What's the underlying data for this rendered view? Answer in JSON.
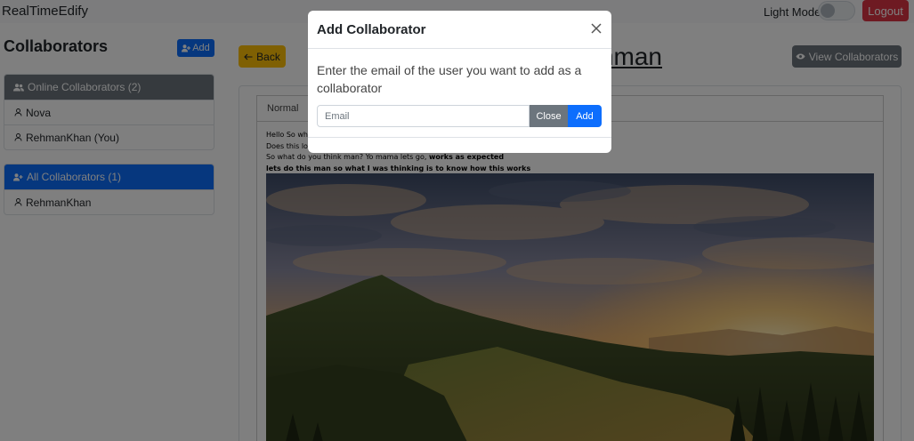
{
  "app": {
    "brand": "RealTimeEdify",
    "theme_label": "Light Mode",
    "logout_label": "Logout"
  },
  "sidebar": {
    "title": "Collaborators",
    "add_label": "Add",
    "online_header": "Online Collaborators (2)",
    "online_items": [
      "Nova",
      "RehmanKhan (You)"
    ],
    "all_header": "All Collaborators (1)",
    "all_items": [
      "RehmanKhan"
    ]
  },
  "main": {
    "back_label": "Back",
    "doc_title": "Khan Rehman",
    "view_collaborators_label": "View Collaborators",
    "toolbar_format": "Normal",
    "editor_lines": [
      "Hello So wh",
      "Does this lo",
      "So what do you think man? Yo mama lets go, ",
      "works as expected",
      "lets do this man so what I was thinking is to know how this works"
    ]
  },
  "modal": {
    "title": "Add Collaborator",
    "description": "Enter the email of the user you want to add as a collaborator",
    "email_placeholder": "Email",
    "close_label": "Close",
    "add_label": "Add"
  },
  "colors": {
    "primary": "#0d6efd",
    "secondary": "#6c757d",
    "warning": "#ffc107",
    "danger": "#dc3545"
  },
  "icons": {
    "sidebar_add": "user-plus-icon",
    "online_header": "users-icon",
    "all_header": "user-plus-icon",
    "collaborator": "user-icon",
    "back": "arrow-left-icon",
    "view_collaborators": "eye-icon",
    "modal_close": "close-icon"
  }
}
